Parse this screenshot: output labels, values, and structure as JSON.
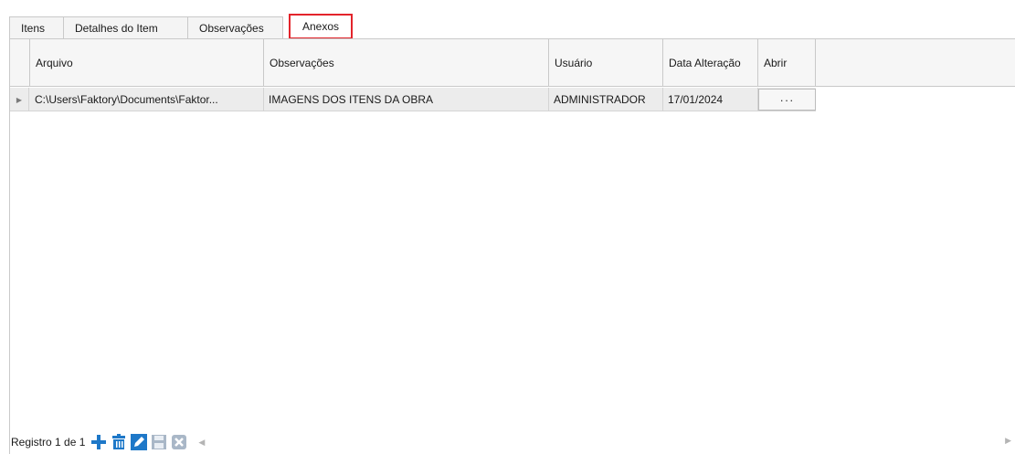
{
  "tabs": [
    {
      "label": "Itens"
    },
    {
      "label": "Detalhes do Item"
    },
    {
      "label": "Observações"
    },
    {
      "label": "Anexos"
    }
  ],
  "grid": {
    "columns": {
      "arquivo": "Arquivo",
      "observacoes": "Observações",
      "usuario": "Usuário",
      "data_alteracao": "Data Alteração",
      "abrir": "Abrir"
    },
    "rows": [
      {
        "arquivo": "C:\\Users\\Faktory\\Documents\\Faktor...",
        "observacoes": "IMAGENS DOS ITENS DA OBRA",
        "usuario": "ADMINISTRADOR",
        "data_alteracao": "17/01/2024",
        "abrir": "···"
      }
    ]
  },
  "navigator": {
    "record_text": "Registro 1 de 1",
    "buttons": [
      "add-icon",
      "delete-icon",
      "edit-icon",
      "save-icon",
      "cancel-icon"
    ]
  },
  "colors": {
    "active_tab_border": "#e3242b",
    "nav_icon_blue": "#1e78c8"
  }
}
